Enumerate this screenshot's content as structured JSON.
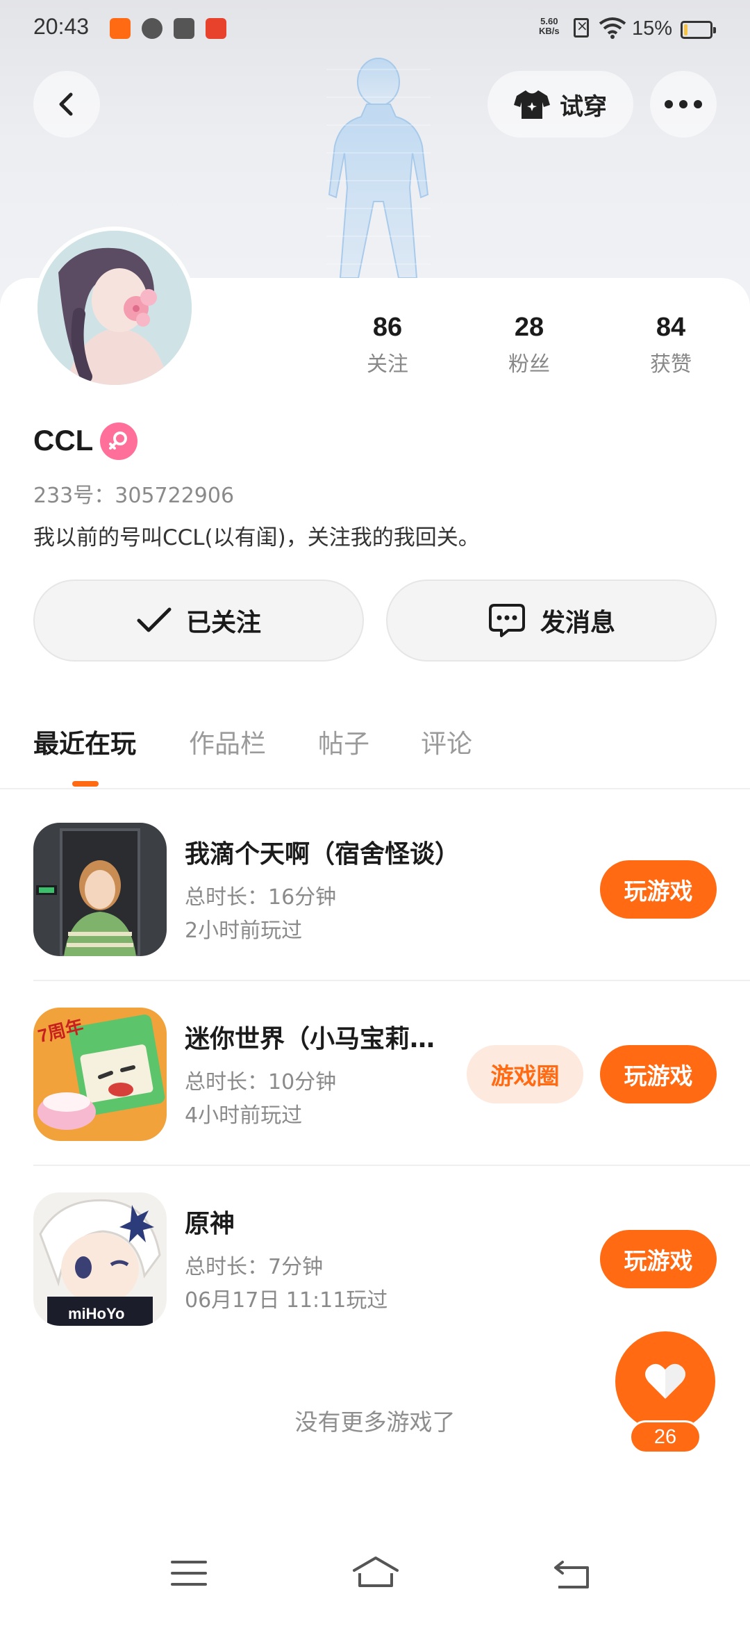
{
  "status_bar": {
    "time": "20:43",
    "net_speed_value": "5.60",
    "net_speed_unit": "KB/s",
    "battery_pct": "15%",
    "battery_level": 0.15
  },
  "header": {
    "tryon_label": "试穿"
  },
  "profile": {
    "stats": [
      {
        "value": "86",
        "label": "关注"
      },
      {
        "value": "28",
        "label": "粉丝"
      },
      {
        "value": "84",
        "label": "获赞"
      }
    ],
    "username": "CCL",
    "uid": "233号：305722906",
    "bio": "我以前的号叫CCL(以有闺)，关注我的我回关。",
    "follow_label": "已关注",
    "message_label": "发消息"
  },
  "tabs": [
    {
      "label": "最近在玩",
      "active": true
    },
    {
      "label": "作品栏",
      "active": false
    },
    {
      "label": "帖子",
      "active": false
    },
    {
      "label": "评论",
      "active": false
    }
  ],
  "games": [
    {
      "title": "我滴个天啊（宿舍怪谈）",
      "duration": "总时长：16分钟",
      "last_played": "2小时前玩过",
      "play_label": "玩游戏"
    },
    {
      "title": "迷你世界（小马宝莉…",
      "duration": "总时长：10分钟",
      "last_played": "4小时前玩过",
      "play_label": "玩游戏",
      "circle_label": "游戏圈"
    },
    {
      "title": "原神",
      "duration": "总时长：7分钟",
      "last_played": "06月17日 11:11玩过",
      "play_label": "玩游戏"
    }
  ],
  "game_icon_texts": {
    "minecraft_badge": "7周年",
    "genshin_brand": "miHoYo"
  },
  "footer": {
    "no_more": "没有更多游戏了"
  },
  "like": {
    "count": "26"
  },
  "colors": {
    "accent": "#ff6a12",
    "accent_soft": "#fde9dd",
    "gender": "#ff6f9a"
  }
}
